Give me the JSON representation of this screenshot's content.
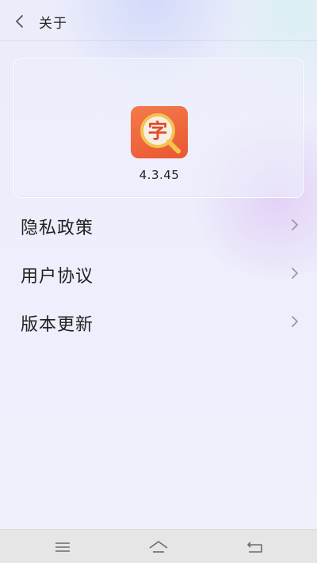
{
  "header": {
    "title": "关于",
    "back_icon": "back-arrow-icon"
  },
  "app": {
    "icon": "app-logo-zi-magnifier",
    "icon_character": "字",
    "version": "4.3.45",
    "accent": "#e95731"
  },
  "menu": {
    "items": [
      {
        "label": "隐私政策",
        "icon": "chevron-right-icon"
      },
      {
        "label": "用户协议",
        "icon": "chevron-right-icon"
      },
      {
        "label": "版本更新",
        "icon": "chevron-right-icon"
      }
    ]
  },
  "navbar": {
    "buttons": [
      "menu-icon",
      "home-icon",
      "back-icon"
    ]
  }
}
